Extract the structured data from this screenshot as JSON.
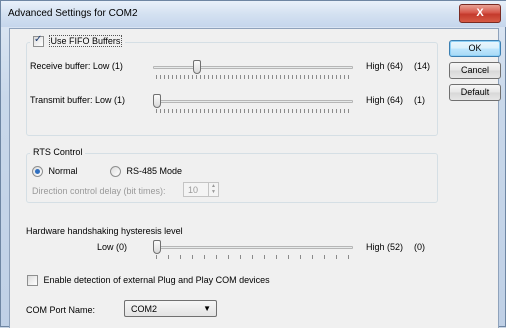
{
  "window": {
    "title": "Advanced Settings for COM2",
    "close_label": "X"
  },
  "buttons": {
    "ok": "OK",
    "cancel": "Cancel",
    "default": "Default"
  },
  "fifo": {
    "checkbox_label": "Use FIFO Buffers",
    "checked": true,
    "receive": {
      "label": "Receive buffer:  Low (1)",
      "high_label": "High (64)",
      "value_label": "(14)",
      "value": 14,
      "min": 1,
      "max": 64
    },
    "transmit": {
      "label": "Transmit buffer:  Low (1)",
      "high_label": "High (64)",
      "value_label": "(1)",
      "value": 1,
      "min": 1,
      "max": 64
    }
  },
  "rts": {
    "group_label": "RTS Control",
    "normal_label": "Normal",
    "rs485_label": "RS-485 Mode",
    "selected": "Normal",
    "delay_label": "Direction control delay (bit times):",
    "delay_value": "10"
  },
  "hysteresis": {
    "label": "Hardware handshaking hysteresis level",
    "low_label": "Low (0)",
    "high_label": "High (52)",
    "value_label": "(0)",
    "value": 0,
    "min": 0,
    "max": 52
  },
  "pnp": {
    "label": "Enable detection of external Plug and Play COM devices",
    "checked": false
  },
  "com_port": {
    "label": "COM Port Name:",
    "value": "COM2"
  }
}
